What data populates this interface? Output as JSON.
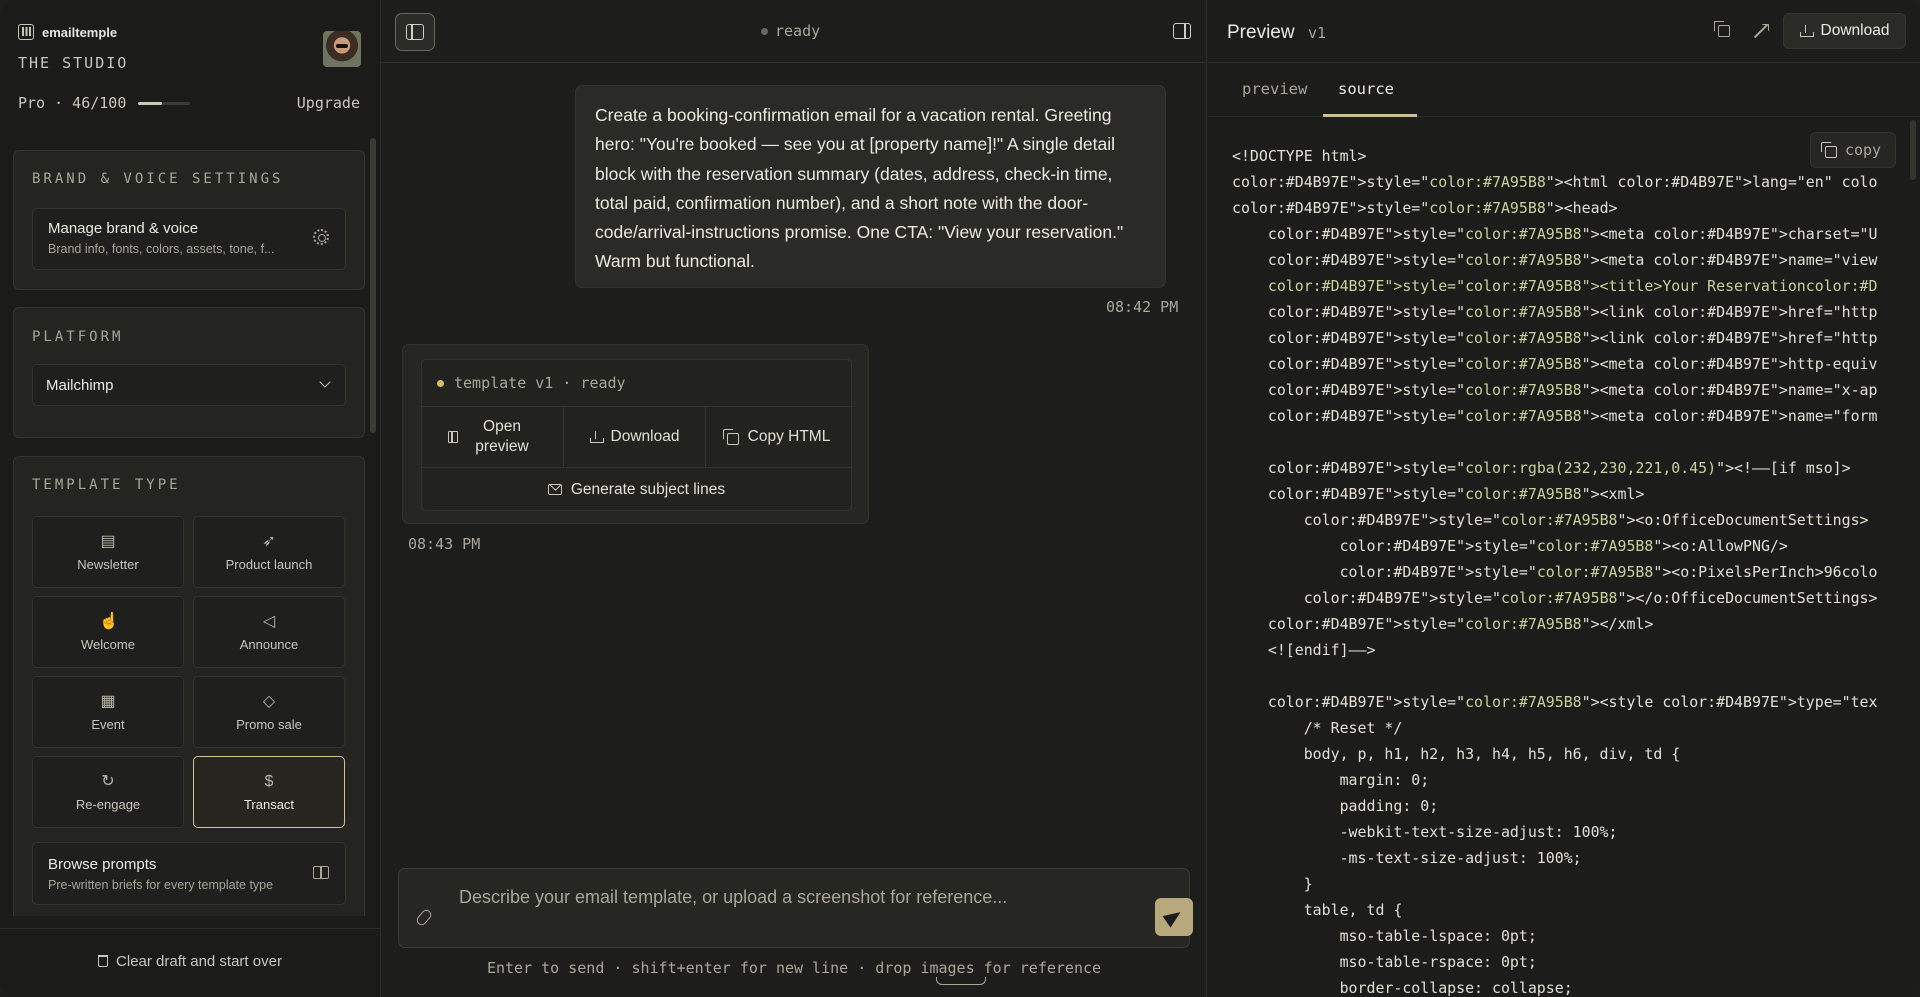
{
  "sidebar": {
    "brand": "emailtemple",
    "studio": "THE STUDIO",
    "plan": "Pro · 46/100",
    "plan_usage_fraction": 0.46,
    "upgrade": "Upgrade",
    "brand_section": {
      "label": "BRAND & VOICE SETTINGS",
      "title": "Manage brand & voice",
      "subtitle": "Brand info, fonts, colors, assets, tone, f..."
    },
    "platform": {
      "label": "PLATFORM",
      "selected": "Mailchimp"
    },
    "template_type": {
      "label": "TEMPLATE TYPE",
      "items": [
        {
          "label": "Newsletter",
          "icon": "newsletter-icon",
          "active": false
        },
        {
          "label": "Product launch",
          "icon": "rocket-icon",
          "active": false
        },
        {
          "label": "Welcome",
          "icon": "hand-icon",
          "active": false
        },
        {
          "label": "Announce",
          "icon": "megaphone-icon",
          "active": false
        },
        {
          "label": "Event",
          "icon": "calendar-icon",
          "active": false
        },
        {
          "label": "Promo sale",
          "icon": "tag-icon",
          "active": false
        },
        {
          "label": "Re-engage",
          "icon": "refresh-icon",
          "active": false
        },
        {
          "label": "Transact",
          "icon": "receipt-icon",
          "active": true
        }
      ]
    },
    "browse": {
      "title": "Browse prompts",
      "subtitle": "Pre-written briefs for every template type"
    },
    "clear": "Clear draft and start over"
  },
  "chat": {
    "status": "ready",
    "user_message": "Create a booking-confirmation email for a vacation rental. Greeting hero: \"You're booked — see you at [property name]!\" A single detail block with the reservation summary (dates, address, check-in time, total paid, confirmation number), and a short note with the door-code/arrival-instructions promise. One CTA: \"View your reservation.\" Warm but functional.",
    "user_time": "08:42 PM",
    "template_status": "template v1 · ready",
    "open_preview": "Open preview",
    "download": "Download",
    "copy_html": "Copy HTML",
    "generate_subjects": "Generate subject lines",
    "reply_time": "08:43 PM",
    "composer_placeholder": "Describe your email template, or upload a screenshot for reference...",
    "hint": "Enter to send · shift+enter for new line · drop images for reference"
  },
  "preview": {
    "title": "Preview",
    "version": "v1",
    "download": "Download",
    "tabs": [
      "preview",
      "source"
    ],
    "active_tab": "source",
    "copy": "copy",
    "code_lines": [
      [
        {
          "t": "<!DOCTYPE html>",
          "c": "w"
        }
      ],
      [
        {
          "t": "color:#D4B97E\">style=\"",
          "c": "w"
        },
        {
          "t": "color:#7A95B8",
          "c": "g"
        },
        {
          "t": "\"><html color:#D4B97E\">lang=\"en\" colo",
          "c": "w"
        }
      ],
      [
        {
          "t": "color:#D4B97E\">style=\"",
          "c": "w"
        },
        {
          "t": "color:#7A95B8",
          "c": "g"
        },
        {
          "t": "\"><head>",
          "c": "w"
        }
      ],
      [
        {
          "t": "    color:#D4B97E\">style=\"",
          "c": "w"
        },
        {
          "t": "color:#7A95B8",
          "c": "g"
        },
        {
          "t": "\"><meta color:#D4B97E\">charset=\"U",
          "c": "w"
        }
      ],
      [
        {
          "t": "    color:#D4B97E\">style=\"",
          "c": "w"
        },
        {
          "t": "color:#7A95B8",
          "c": "g"
        },
        {
          "t": "\"><meta color:#D4B97E\">name=\"view",
          "c": "w"
        }
      ],
      [
        {
          "t": "    color:#D4B97E\">style=\"color:#7A95B8\"><title>Your Reservationcolor:#D",
          "c": "g"
        }
      ],
      [
        {
          "t": "    color:#D4B97E\">style=\"",
          "c": "w"
        },
        {
          "t": "color:#7A95B8",
          "c": "g"
        },
        {
          "t": "\"><link color:#D4B97E\">href=\"http",
          "c": "w"
        }
      ],
      [
        {
          "t": "    color:#D4B97E\">style=\"",
          "c": "w"
        },
        {
          "t": "color:#7A95B8",
          "c": "g"
        },
        {
          "t": "\"><link color:#D4B97E\">href=\"http",
          "c": "w"
        }
      ],
      [
        {
          "t": "    color:#D4B97E\">style=\"",
          "c": "w"
        },
        {
          "t": "color:#7A95B8",
          "c": "g"
        },
        {
          "t": "\"><meta color:#D4B97E\">http-equiv",
          "c": "w"
        }
      ],
      [
        {
          "t": "    color:#D4B97E\">style=\"",
          "c": "w"
        },
        {
          "t": "color:#7A95B8",
          "c": "g"
        },
        {
          "t": "\"><meta color:#D4B97E\">name=\"x-ap",
          "c": "w"
        }
      ],
      [
        {
          "t": "    color:#D4B97E\">style=\"",
          "c": "w"
        },
        {
          "t": "color:#7A95B8",
          "c": "g"
        },
        {
          "t": "\"><meta color:#D4B97E\">name=\"form",
          "c": "w"
        }
      ],
      [
        {
          "t": "",
          "c": "w"
        }
      ],
      [
        {
          "t": "    color:#D4B97E\">style=\"",
          "c": "w"
        },
        {
          "t": "color:rgba(232,230,221,0.45)",
          "c": "g"
        },
        {
          "t": "\"><!——[if mso]>",
          "c": "w"
        }
      ],
      [
        {
          "t": "    color:#D4B97E\">style=\"",
          "c": "w"
        },
        {
          "t": "color:#7A95B8",
          "c": "g"
        },
        {
          "t": "\"><xml>",
          "c": "w"
        }
      ],
      [
        {
          "t": "        color:#D4B97E\">style=\"",
          "c": "w"
        },
        {
          "t": "color:#7A95B8",
          "c": "g"
        },
        {
          "t": "\"><o:OfficeDocumentSettings>",
          "c": "w"
        }
      ],
      [
        {
          "t": "            color:#D4B97E\">style=\"",
          "c": "w"
        },
        {
          "t": "color:#7A95B8",
          "c": "g"
        },
        {
          "t": "\"><o:AllowPNG/>",
          "c": "w"
        }
      ],
      [
        {
          "t": "            color:#D4B97E\">style=\"",
          "c": "w"
        },
        {
          "t": "color:#7A95B8",
          "c": "g"
        },
        {
          "t": "\"><o:PixelsPerInch>96colo",
          "c": "w"
        }
      ],
      [
        {
          "t": "        color:#D4B97E\">style=\"",
          "c": "w"
        },
        {
          "t": "color:#7A95B8",
          "c": "g"
        },
        {
          "t": "\"></o:OfficeDocumentSettings>",
          "c": "w"
        }
      ],
      [
        {
          "t": "    color:#D4B97E\">style=\"",
          "c": "w"
        },
        {
          "t": "color:#7A95B8",
          "c": "g"
        },
        {
          "t": "\"></xml>",
          "c": "w"
        }
      ],
      [
        {
          "t": "    <![endif]——>",
          "c": "w"
        }
      ],
      [
        {
          "t": "",
          "c": "w"
        }
      ],
      [
        {
          "t": "    color:#D4B97E\">style=\"",
          "c": "w"
        },
        {
          "t": "color:#7A95B8",
          "c": "g"
        },
        {
          "t": "\"><style color:#D4B97E\">type=\"tex",
          "c": "w"
        }
      ],
      [
        {
          "t": "        /* Reset */",
          "c": "w"
        }
      ],
      [
        {
          "t": "        body, p, h1, h2, h3, h4, h5, h6, div, td {",
          "c": "w"
        }
      ],
      [
        {
          "t": "            margin: 0;",
          "c": "w"
        }
      ],
      [
        {
          "t": "            padding: 0;",
          "c": "w"
        }
      ],
      [
        {
          "t": "            -webkit-text-size-adjust: 100%;",
          "c": "w"
        }
      ],
      [
        {
          "t": "            -ms-text-size-adjust: 100%;",
          "c": "w"
        }
      ],
      [
        {
          "t": "        }",
          "c": "w"
        }
      ],
      [
        {
          "t": "        table, td {",
          "c": "w"
        }
      ],
      [
        {
          "t": "            mso-table-lspace: 0pt;",
          "c": "w"
        }
      ],
      [
        {
          "t": "            mso-table-rspace: 0pt;",
          "c": "w"
        }
      ],
      [
        {
          "t": "            border-collapse: collapse;",
          "c": "w"
        }
      ]
    ]
  },
  "colors": {
    "background": "#1d1d1b",
    "accent": "#cfc09a",
    "send_button": "#b8a97c",
    "code_green": "#c7d29b"
  }
}
